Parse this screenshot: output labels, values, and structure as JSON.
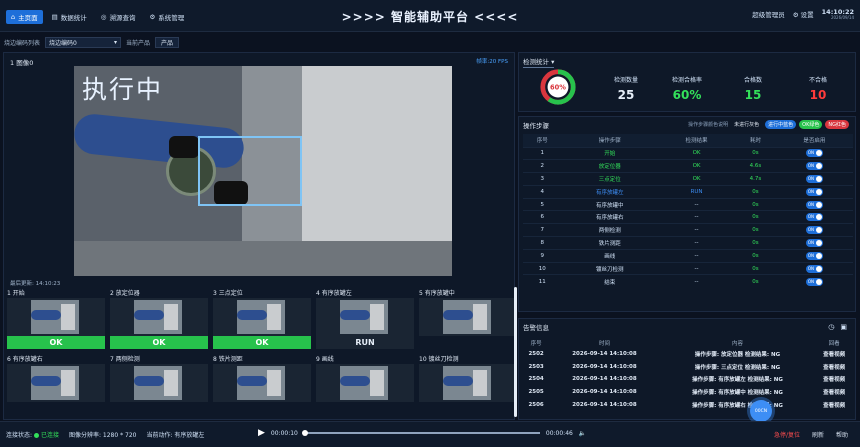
{
  "nav": [
    {
      "icon": "⌂",
      "label": "主页面",
      "active": true
    },
    {
      "icon": "▤",
      "label": "数据统计"
    },
    {
      "icon": "◎",
      "label": "溯源查询"
    },
    {
      "icon": "⚙",
      "label": "系统管理"
    }
  ],
  "title": ">>>> 智能辅助平台 <<<<",
  "header_right": {
    "user": "超级管理员",
    "settings": "设置",
    "time": "14:10:22",
    "date": "2026/09/14"
  },
  "subbar": {
    "list_label": "烧边编码列表",
    "list_value": "烧边编码0",
    "product_label": "当前产品",
    "product_value": "产品"
  },
  "camera": {
    "label": "1 图像0",
    "fps": "帧率:20 FPS",
    "status_text": "执行中",
    "last_update": "最后更新: 14:10:23"
  },
  "thumbnails": [
    {
      "label": "1 开始",
      "status": "OK"
    },
    {
      "label": "2 放定位器",
      "status": "OK"
    },
    {
      "label": "3 三点定位",
      "status": "OK"
    },
    {
      "label": "4 有序放罐左",
      "status": "RUN"
    },
    {
      "label": "5 有序放罐中",
      "status": ""
    },
    {
      "label": "6 有序放罐右",
      "status": ""
    },
    {
      "label": "7 两侧检测",
      "status": ""
    },
    {
      "label": "8 铁片测距",
      "status": ""
    },
    {
      "label": "9 画线",
      "status": ""
    },
    {
      "label": "10 镀丝刀检测",
      "status": ""
    }
  ],
  "stats": {
    "dropdown": "检测统计",
    "rate_ring": "60%",
    "rate_fraction": 0.6,
    "columns": [
      {
        "label": "检测数量",
        "value": "25",
        "color": "#e6eef8"
      },
      {
        "label": "检测合格率",
        "value": "60%",
        "color": "#33e05a"
      },
      {
        "label": "合格数",
        "value": "15",
        "color": "#33e05a"
      },
      {
        "label": "不合格",
        "value": "10",
        "color": "#ff3b3b"
      }
    ]
  },
  "steps": {
    "title": "操作步骤",
    "legend_note": "操作步骤颜色说明",
    "legend": [
      {
        "label": "未进行灰色",
        "kind": "gray"
      },
      {
        "label": "进行中蓝色",
        "kind": "blue"
      },
      {
        "label": "OK绿色",
        "kind": "green"
      },
      {
        "label": "NG红色",
        "kind": "red"
      }
    ],
    "headers": [
      "序号",
      "操作步骤",
      "检测结果",
      "耗时",
      "是否启用"
    ],
    "rows": [
      {
        "no": "1",
        "name": "开始",
        "result": "OK",
        "time": "0s",
        "state": "ok"
      },
      {
        "no": "2",
        "name": "放定位器",
        "result": "OK",
        "time": "4.6s",
        "state": "ok"
      },
      {
        "no": "3",
        "name": "三点定位",
        "result": "OK",
        "time": "4.7s",
        "state": "ok"
      },
      {
        "no": "4",
        "name": "有序放罐左",
        "result": "RUN",
        "time": "0s",
        "state": "run"
      },
      {
        "no": "5",
        "name": "有序放罐中",
        "result": "--",
        "time": "0s",
        "state": "idle"
      },
      {
        "no": "6",
        "name": "有序放罐右",
        "result": "--",
        "time": "0s",
        "state": "idle"
      },
      {
        "no": "7",
        "name": "两侧检测",
        "result": "--",
        "time": "0s",
        "state": "idle"
      },
      {
        "no": "8",
        "name": "铁片测距",
        "result": "--",
        "time": "0s",
        "state": "idle"
      },
      {
        "no": "9",
        "name": "画线",
        "result": "--",
        "time": "0s",
        "state": "idle"
      },
      {
        "no": "10",
        "name": "镀丝刀检测",
        "result": "--",
        "time": "0s",
        "state": "idle"
      },
      {
        "no": "11",
        "name": "结束",
        "result": "--",
        "time": "0s",
        "state": "idle"
      }
    ]
  },
  "alarms": {
    "title": "告警信息",
    "headers": [
      "序号",
      "时间",
      "内容",
      "回看"
    ],
    "rows": [
      {
        "no": "2502",
        "time": "2026-09-14 14:10:08",
        "content": "操作步骤: 放定位器 检测结果: NG",
        "action": "查看视频"
      },
      {
        "no": "2503",
        "time": "2026-09-14 14:10:08",
        "content": "操作步骤: 三点定位 检测结果: NG",
        "action": "查看视频"
      },
      {
        "no": "2504",
        "time": "2026-09-14 14:10:08",
        "content": "操作步骤: 有序放罐左 检测结果: NG",
        "action": "查看视频"
      },
      {
        "no": "2505",
        "time": "2026-09-14 14:10:08",
        "content": "操作步骤: 有序放罐中 检测结果: NG",
        "action": "查看视频"
      },
      {
        "no": "2506",
        "time": "2026-09-14 14:10:08",
        "content": "操作步骤: 有序放罐右 检测结果: NG",
        "action": "查看视频"
      }
    ],
    "fab_label": "00CN"
  },
  "footer": {
    "conn_label": "连接状态:",
    "conn_value": "已连接",
    "res_label": "图像分辨率:",
    "res_value": "1280 * 720",
    "action_label": "当前动作:",
    "action_value": "有序放罐左",
    "time_start": "00:00:10",
    "time_end": "00:00:46",
    "btn_stop": "急停/复位",
    "btn_refresh": "刷新",
    "btn_help": "帮助"
  }
}
